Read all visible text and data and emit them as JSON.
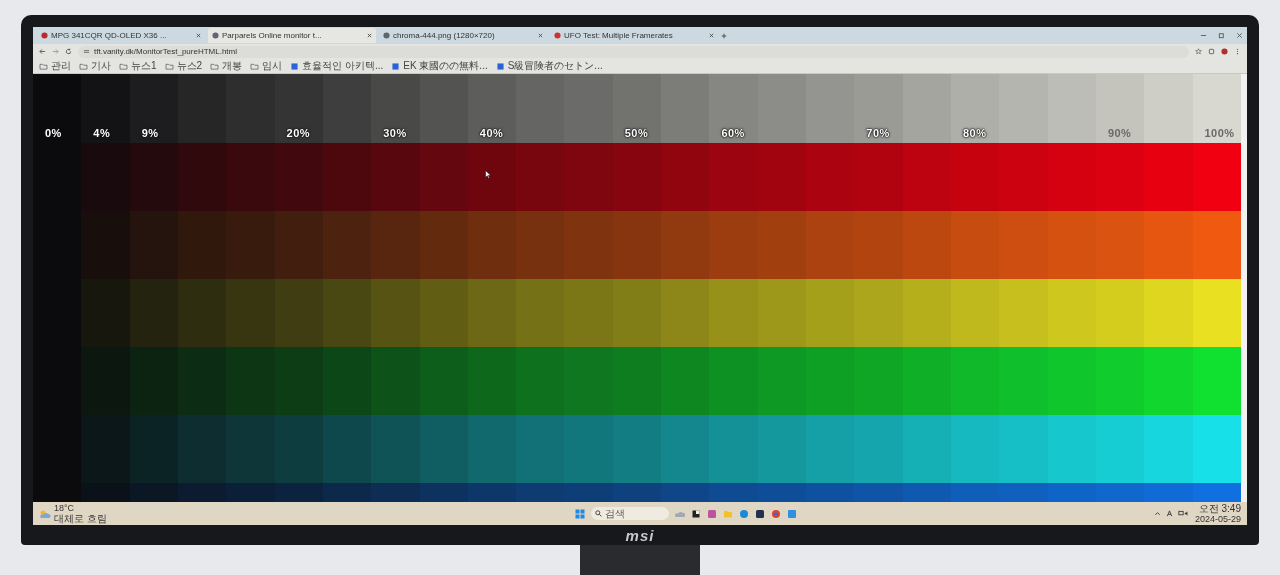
{
  "browser": {
    "tabs": [
      {
        "title": "MPG 341CQR QD-OLED X36 ...",
        "selected": false
      },
      {
        "title": "Parparels Online monitor t...",
        "selected": true
      },
      {
        "title": "chroma-444.png (1280×720)",
        "selected": false
      },
      {
        "title": "UFO Test: Multiple Framerates",
        "selected": false
      }
    ],
    "address": "tft.vanity.dk/MonitorTest_pureHTML.html",
    "bookmarks": [
      {
        "kind": "folder",
        "title": "관리"
      },
      {
        "kind": "folder",
        "title": "기사"
      },
      {
        "kind": "folder",
        "title": "뉴스1"
      },
      {
        "kind": "folder",
        "title": "뉴스2"
      },
      {
        "kind": "folder",
        "title": "개봉"
      },
      {
        "kind": "folder",
        "title": "임시"
      },
      {
        "kind": "page",
        "title": "효율적인 아키텍..."
      },
      {
        "kind": "page",
        "title": "EK 東國のの無料..."
      },
      {
        "kind": "page",
        "title": "S級冒険者のセトン..."
      }
    ]
  },
  "test_pattern": {
    "columns": [
      {
        "level": 0,
        "label": "0%"
      },
      {
        "level": 0.04,
        "label": "4%"
      },
      {
        "level": 0.09,
        "label": "9%"
      },
      {
        "level": 0.13
      },
      {
        "level": 0.17
      },
      {
        "level": 0.2,
        "label": "20%"
      },
      {
        "level": 0.25
      },
      {
        "level": 0.3,
        "label": "30%"
      },
      {
        "level": 0.35
      },
      {
        "level": 0.4,
        "label": "40%"
      },
      {
        "level": 0.44
      },
      {
        "level": 0.47
      },
      {
        "level": 0.5,
        "label": "50%"
      },
      {
        "level": 0.55
      },
      {
        "level": 0.6,
        "label": "60%"
      },
      {
        "level": 0.63
      },
      {
        "level": 0.67
      },
      {
        "level": 0.7,
        "label": "70%"
      },
      {
        "level": 0.75
      },
      {
        "level": 0.8,
        "label": "80%"
      },
      {
        "level": 0.83
      },
      {
        "level": 0.87
      },
      {
        "level": 0.9,
        "label": "90%"
      },
      {
        "level": 0.95
      },
      {
        "level": 1,
        "label": "100%"
      }
    ],
    "rows": [
      {
        "color": "#d8d8d0"
      },
      {
        "color": "#f00010"
      },
      {
        "color": "#f05a10"
      },
      {
        "color": "#e8e020"
      },
      {
        "color": "#10e030"
      },
      {
        "color": "#18e0e8"
      },
      {
        "color": "#1070e0"
      }
    ]
  },
  "taskbar": {
    "weather_temp": "18°C",
    "weather_text": "대체로 흐림",
    "search_placeholder": "검색",
    "time": "오전 3:49",
    "date": "2024-05-29"
  },
  "brand": "msi"
}
